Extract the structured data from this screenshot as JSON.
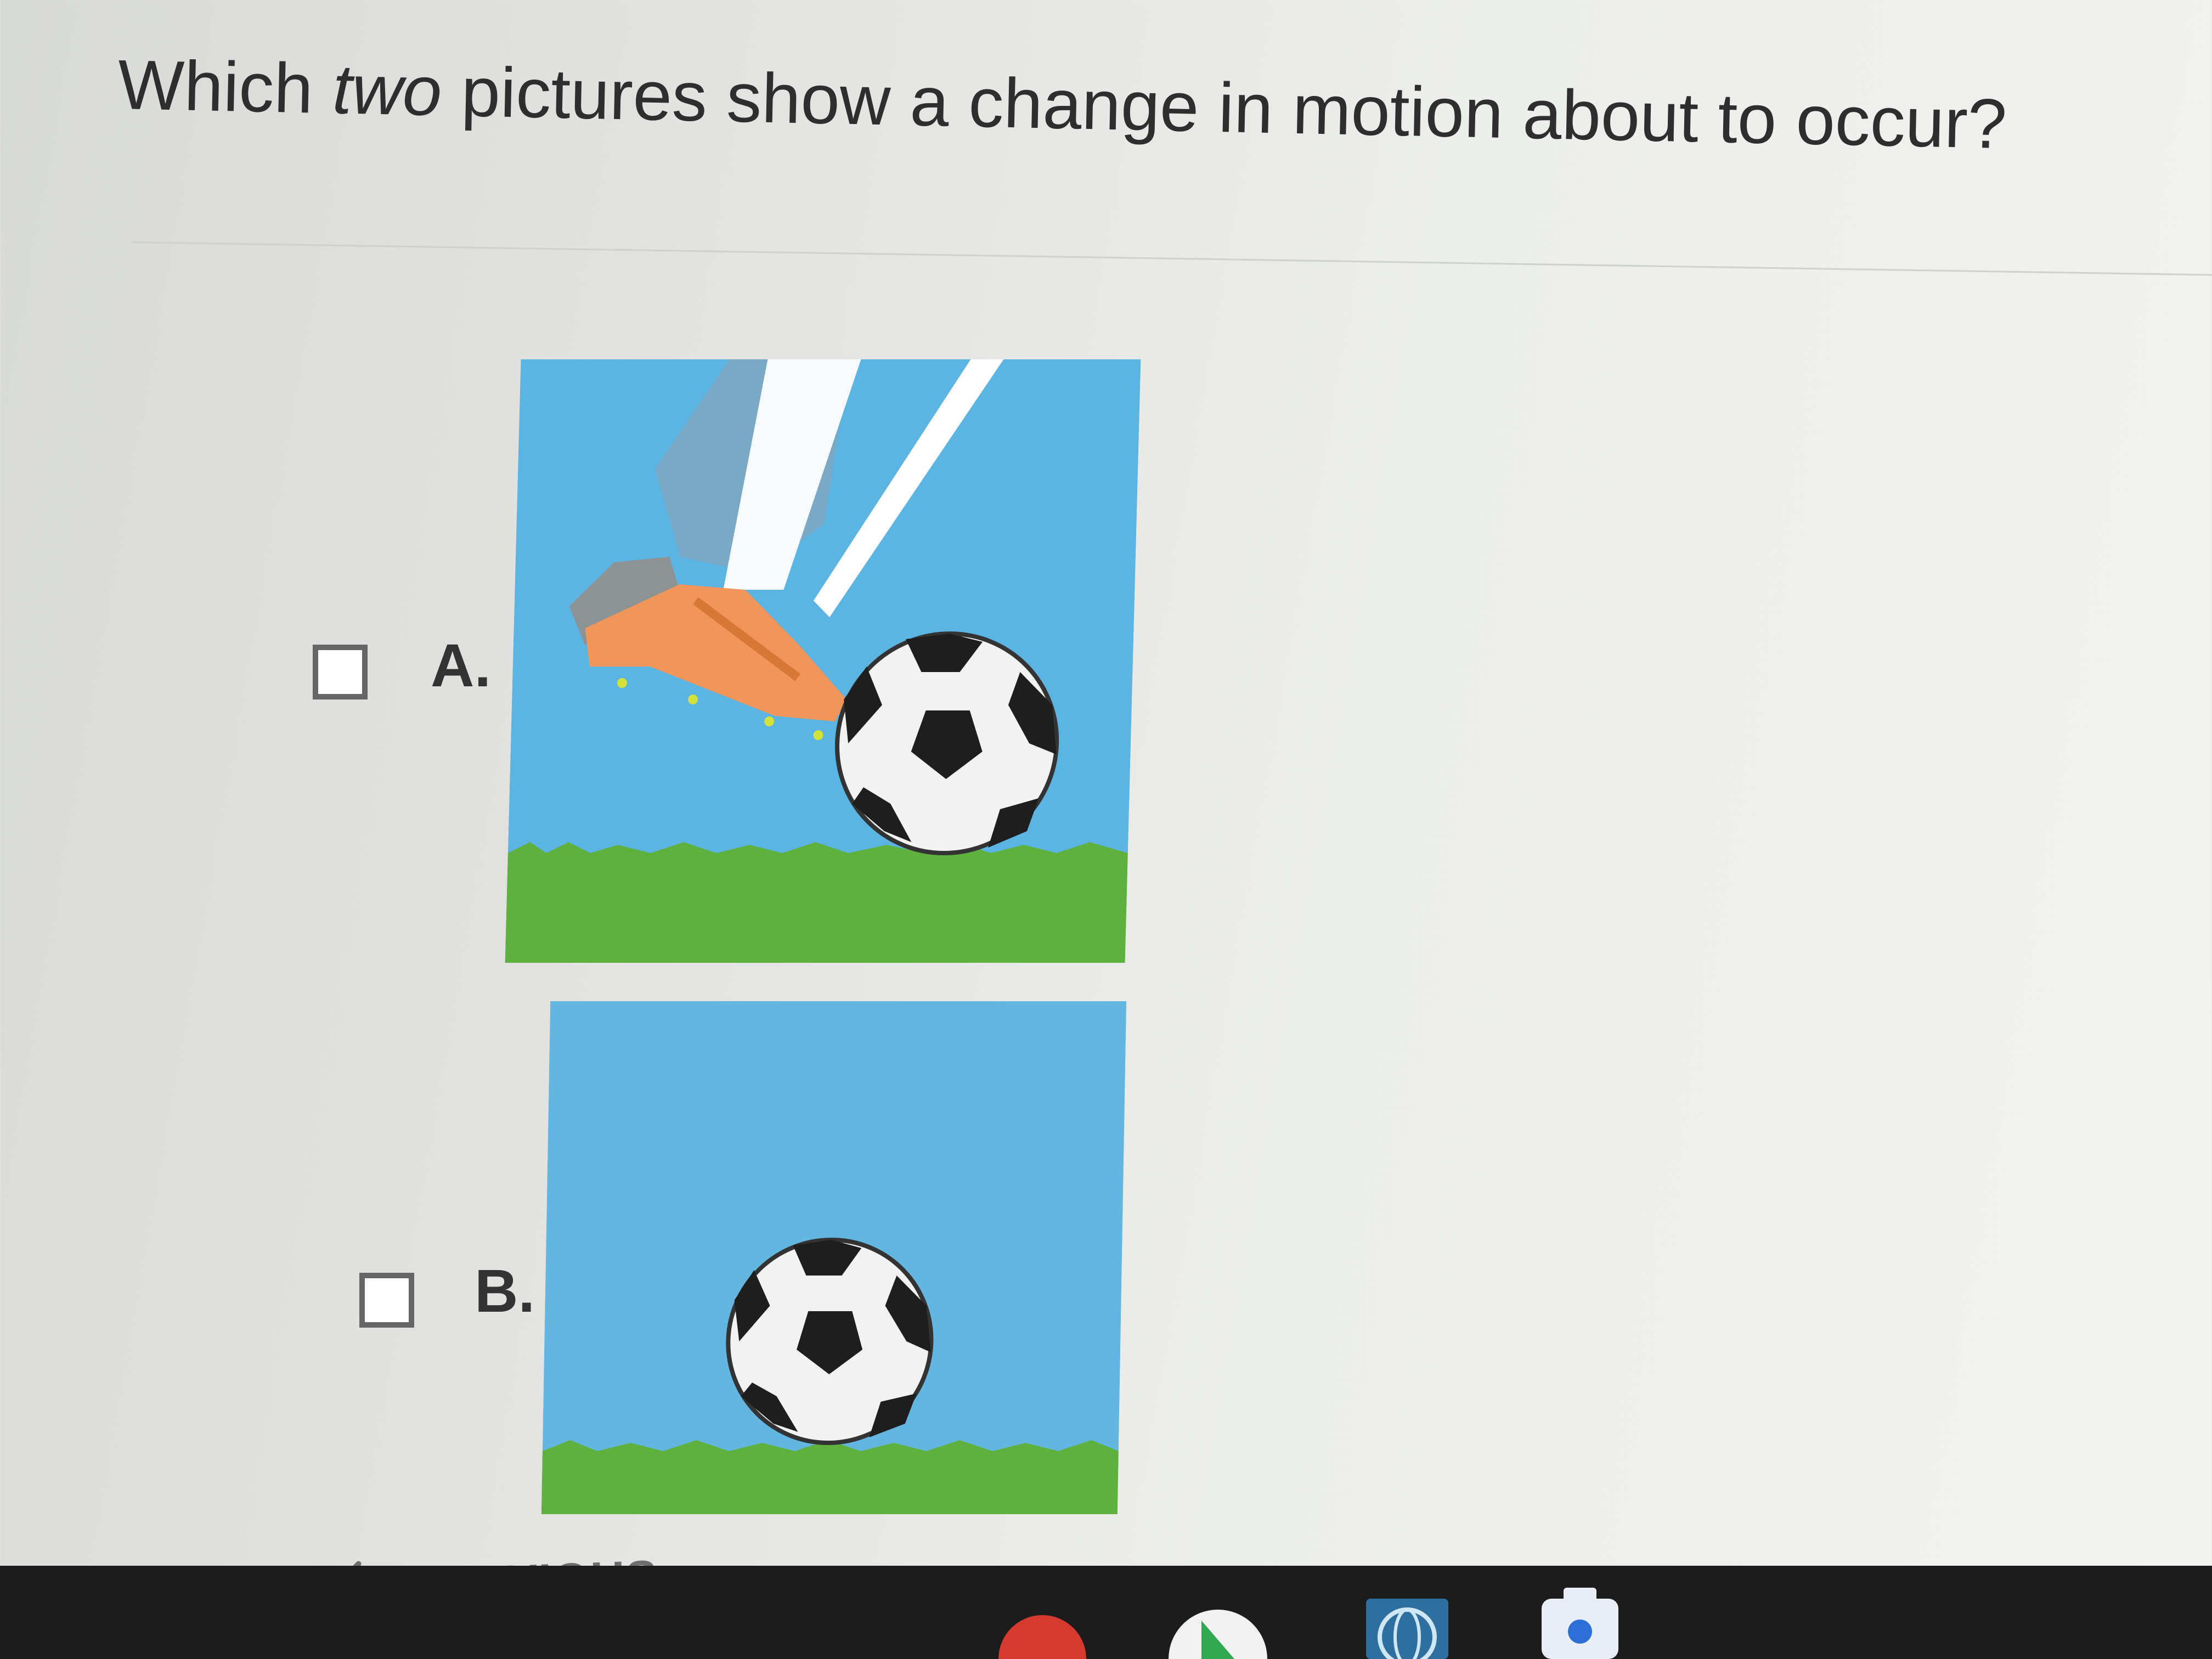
{
  "question": {
    "before": "Which ",
    "emphasis": "two",
    "after": " pictures show a change in motion about to occur?"
  },
  "options": [
    {
      "label": "A.",
      "checked": false,
      "image": "foot-kicking-soccer-ball"
    },
    {
      "label": "B.",
      "checked": false,
      "image": "soccer-ball-on-grass"
    }
  ],
  "navigation": {
    "previous_label": "PREVIOUS",
    "previous_icon": "arrow-left-icon"
  },
  "taskbar": {
    "icons": [
      "chrome-icon",
      "play-store-icon",
      "globe-app-icon",
      "camera-app-icon"
    ]
  },
  "colors": {
    "sky": "#5cb4e2",
    "grass": "#5fb13d",
    "shoe": "#f0965a",
    "sock": "#8d9394",
    "checkbox_border": "#666666"
  }
}
